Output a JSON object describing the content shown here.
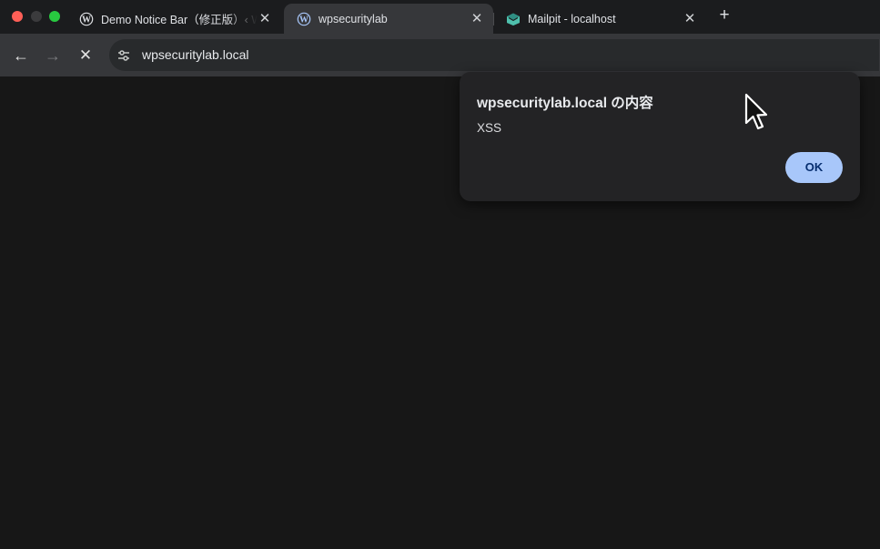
{
  "tabs": [
    {
      "title": "Demo Notice Bar（修正版）‹ W",
      "favicon": "wordpress-icon",
      "active": false
    },
    {
      "title": "wpsecuritylab",
      "favicon": "wordpress-icon",
      "active": true
    },
    {
      "title": "Mailpit - localhost",
      "favicon": "mailpit-icon",
      "active": false
    }
  ],
  "toolbar": {
    "url": "wpsecuritylab.local",
    "back_icon": "←",
    "forward_icon": "→",
    "stop_icon": "✕",
    "newtab_icon": "+",
    "close_icon": "✕"
  },
  "dialog": {
    "title": "wpsecuritylab.local の内容",
    "message": "XSS",
    "ok_label": "OK"
  },
  "colors": {
    "accent": "#a8c7fa",
    "page_background": "#171717",
    "dialog_background": "#232325"
  }
}
